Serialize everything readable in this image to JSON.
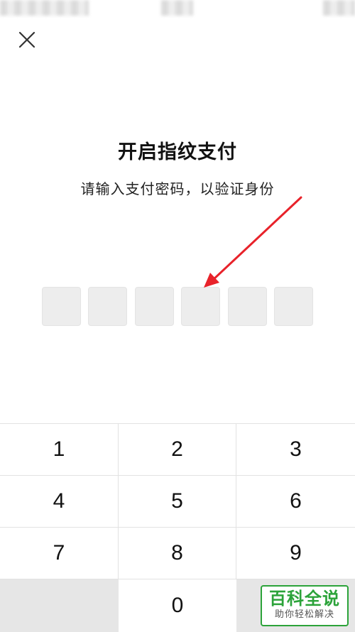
{
  "header": {
    "close_icon": "close-icon",
    "title": "开启指纹支付",
    "subtitle": "请输入支付密码，以验证身份"
  },
  "pin": {
    "length": 6,
    "filled": 0
  },
  "annotation": {
    "arrow_color": "#e8222a"
  },
  "keypad": {
    "keys": [
      "1",
      "2",
      "3",
      "4",
      "5",
      "6",
      "7",
      "8",
      "9",
      "",
      "0",
      ""
    ]
  },
  "watermark": {
    "main": "百科全说",
    "sub": "助你轻松解决",
    "color": "#2ca33a"
  }
}
